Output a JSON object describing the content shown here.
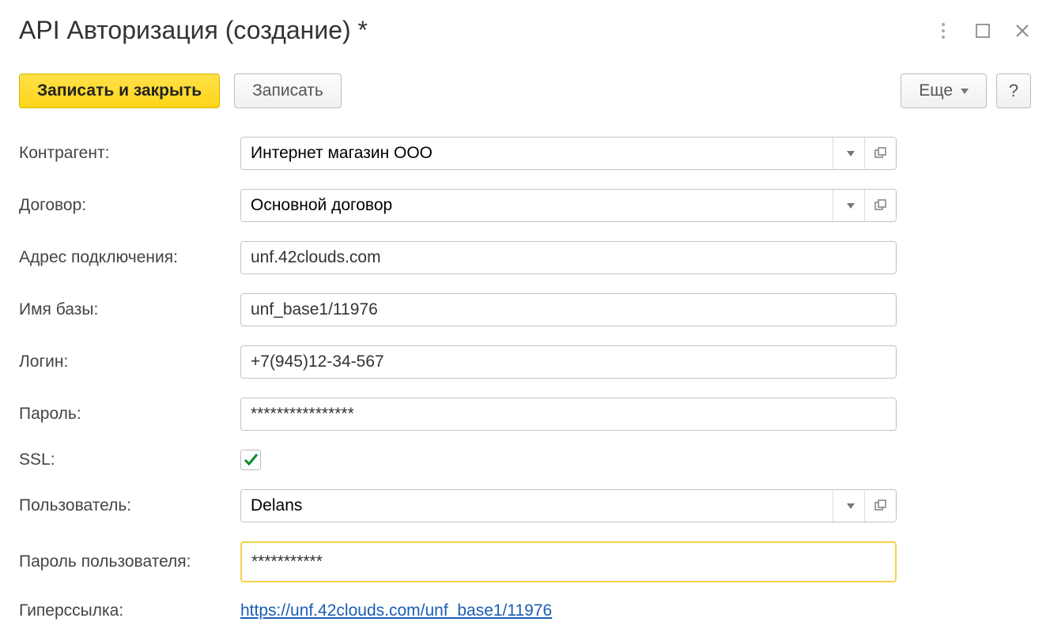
{
  "header": {
    "title": "API Авторизация (создание) *"
  },
  "toolbar": {
    "save_close": "Записать и закрыть",
    "save": "Записать",
    "more": "Еще",
    "help": "?"
  },
  "form": {
    "counterparty": {
      "label": "Контрагент:",
      "value": "Интернет магазин ООО"
    },
    "contract": {
      "label": "Договор:",
      "value": "Основной договор"
    },
    "address": {
      "label": "Адрес подключения:",
      "value": "unf.42clouds.com"
    },
    "basename": {
      "label": "Имя базы:",
      "value": "unf_base1/11976"
    },
    "login": {
      "label": "Логин:",
      "value": "+7(945)12-34-567"
    },
    "password": {
      "label": "Пароль:",
      "value": "****************"
    },
    "ssl": {
      "label": "SSL:",
      "checked": true
    },
    "user": {
      "label": "Пользователь:",
      "value": "Delans"
    },
    "user_password": {
      "label": "Пароль пользователя:",
      "value": "***********"
    },
    "hyperlink": {
      "label": "Гиперссылка:",
      "value": "https://unf.42clouds.com/unf_base1/11976"
    }
  }
}
